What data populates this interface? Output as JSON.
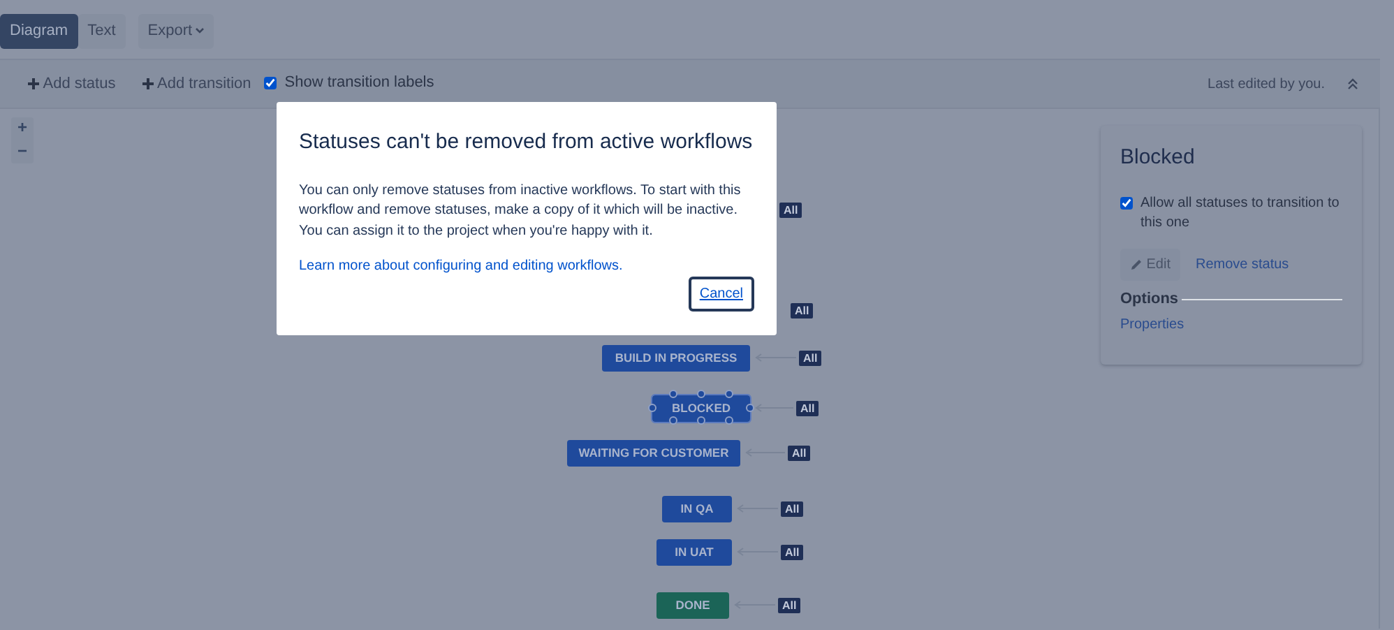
{
  "view_tabs": [
    {
      "label": "Diagram",
      "selected": true
    },
    {
      "label": "Text",
      "selected": false
    }
  ],
  "export_button": {
    "label": "Export"
  },
  "toolbar": {
    "add_status": "Add status",
    "add_transition": "Add transition",
    "show_labels": {
      "label": "Show transition labels",
      "checked": true
    },
    "last_edited": "Last edited by you."
  },
  "zoom": {
    "zoom_in": "+",
    "zoom_out": "−"
  },
  "covered_badges": [
    "All",
    "All"
  ],
  "statuses": [
    {
      "label": "BUILD IN PROGRESS",
      "kind": "progress",
      "selected": false,
      "badge": "All"
    },
    {
      "label": "BLOCKED",
      "kind": "progress",
      "selected": true,
      "badge": "All"
    },
    {
      "label": "WAITING FOR CUSTOMER",
      "kind": "progress",
      "selected": false,
      "badge": "All"
    },
    {
      "label": "IN QA",
      "kind": "progress",
      "selected": false,
      "badge": "All"
    },
    {
      "label": "IN UAT",
      "kind": "progress",
      "selected": false,
      "badge": "All"
    },
    {
      "label": "DONE",
      "kind": "done",
      "selected": false,
      "badge": "All"
    }
  ],
  "side_panel": {
    "title": "Blocked",
    "allow_all": {
      "label": "Allow all statuses to transition to this one",
      "checked": true
    },
    "edit": "Edit",
    "remove": "Remove status",
    "options_heading": "Options",
    "properties": "Properties"
  },
  "dialog": {
    "title": "Statuses can't be removed from active workflows",
    "body": "You can only remove statuses from inactive workflows. To start with this workflow and remove statuses, make a copy of it which will be inactive. You can assign it to the project when you're happy with it.",
    "link": "Learn more about configuring and editing workflows.",
    "cancel": "Cancel"
  }
}
